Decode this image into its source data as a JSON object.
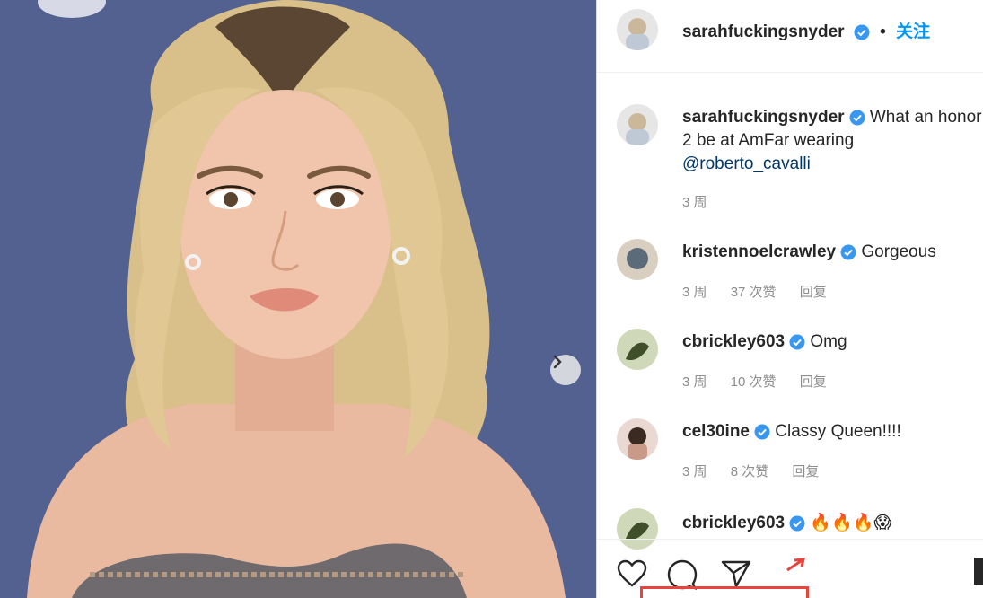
{
  "post": {
    "author": "sarahfuckingsnyder",
    "follow_label": "关注",
    "dot": "•",
    "caption_line1": "What an honor",
    "caption_line2": "2 be at AmFar wearing",
    "caption_mention": "@roberto_cavalli",
    "caption_time": "3 周"
  },
  "comments": [
    {
      "user": "kristennoelcrawley",
      "text": "Gorgeous",
      "time": "3 周",
      "likes": "37 次赞",
      "reply": "回复"
    },
    {
      "user": "cbrickley603",
      "text": "Omg",
      "time": "3 周",
      "likes": "10 次赞",
      "reply": "回复"
    },
    {
      "user": "cel30ine",
      "text": "Classy Queen!!!!",
      "time": "3 周",
      "likes": "8 次赞",
      "reply": "回复"
    },
    {
      "user": "cbrickley603",
      "text": "🔥🔥🔥😱"
    }
  ],
  "icons": [
    "like-icon",
    "comment-icon",
    "share-icon",
    "verified-icon",
    "chevron-right-icon"
  ],
  "colors": {
    "accent": "#0095f6",
    "verified": "#3897f0",
    "highlight_box": "#e8433c"
  }
}
